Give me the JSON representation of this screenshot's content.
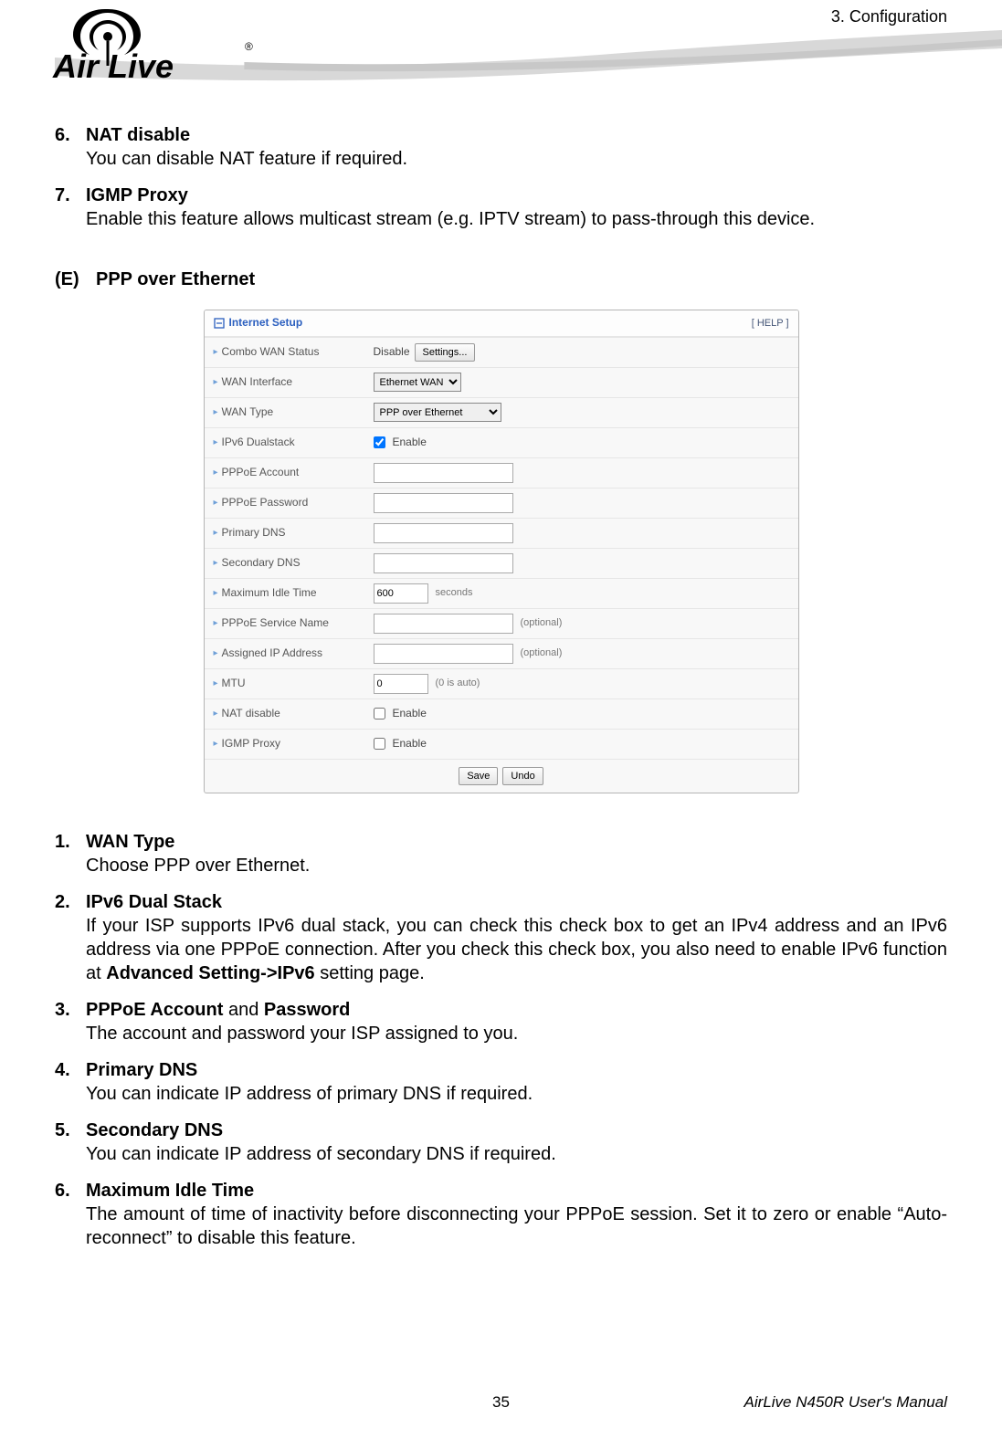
{
  "header": {
    "chapter": "3. Configuration",
    "logo_text": "Air Live",
    "logo_reg": "®"
  },
  "intro_items": [
    {
      "num": "6.",
      "title": "NAT disable",
      "desc": "You can disable NAT feature if required."
    },
    {
      "num": "7.",
      "title": "IGMP Proxy",
      "desc": "Enable this feature allows multicast stream (e.g. IPTV stream) to pass-through this device."
    }
  ],
  "section": {
    "letter": "(E)",
    "title": "PPP over Ethernet"
  },
  "panel": {
    "title": "Internet Setup",
    "help": "[ HELP ]",
    "rows": {
      "combo_wan": {
        "label": "Combo WAN Status",
        "status": "Disable",
        "button": "Settings..."
      },
      "wan_interface": {
        "label": "WAN Interface",
        "options": [
          "Ethernet WAN"
        ]
      },
      "wan_type": {
        "label": "WAN Type",
        "options": [
          "PPP over Ethernet"
        ]
      },
      "ipv6_dualstack": {
        "label": "IPv6 Dualstack",
        "checked": true,
        "text": "Enable"
      },
      "pppoe_account": {
        "label": "PPPoE Account",
        "value": ""
      },
      "pppoe_password": {
        "label": "PPPoE Password",
        "value": ""
      },
      "primary_dns": {
        "label": "Primary DNS",
        "value": ""
      },
      "secondary_dns": {
        "label": "Secondary DNS",
        "value": ""
      },
      "max_idle": {
        "label": "Maximum Idle Time",
        "value": "600",
        "suffix": "seconds"
      },
      "service_name": {
        "label": "PPPoE Service Name",
        "value": "",
        "optional": "(optional)"
      },
      "assigned_ip": {
        "label": "Assigned IP Address",
        "value": "",
        "optional": "(optional)"
      },
      "mtu": {
        "label": "MTU",
        "value": "0",
        "suffix": "(0 is auto)"
      },
      "nat_disable": {
        "label": "NAT disable",
        "checked": false,
        "text": "Enable"
      },
      "igmp_proxy": {
        "label": "IGMP Proxy",
        "checked": false,
        "text": "Enable"
      }
    },
    "buttons": {
      "save": "Save",
      "undo": "Undo"
    }
  },
  "descriptions": [
    {
      "num": "1.",
      "title": "WAN Type",
      "desc": "Choose PPP over Ethernet."
    },
    {
      "num": "2.",
      "title": "IPv6 Dual Stack",
      "desc_parts": [
        "If your ISP supports IPv6 dual stack, you can check this check box to get an IPv4 address and an IPv6 address via one PPPoE connection. After you check this check box, you also need to enable IPv6 function at ",
        "Advanced Setting->IPv6",
        " setting page."
      ]
    },
    {
      "num": "3.",
      "title_parts": [
        "PPPoE Account",
        " and ",
        "Password"
      ],
      "desc": "The account and password your ISP assigned to you."
    },
    {
      "num": "4.",
      "title": "Primary DNS",
      "desc": "You can indicate IP address of primary DNS if required."
    },
    {
      "num": "5.",
      "title": "Secondary DNS",
      "desc": "You can indicate IP address of secondary DNS if required."
    },
    {
      "num": "6.",
      "title": "Maximum Idle Time",
      "desc": "The amount of time of inactivity before disconnecting your PPPoE session. Set it to zero or enable “Auto-reconnect” to disable this feature."
    }
  ],
  "footer": {
    "page_number": "35",
    "manual": "AirLive N450R User's Manual"
  }
}
